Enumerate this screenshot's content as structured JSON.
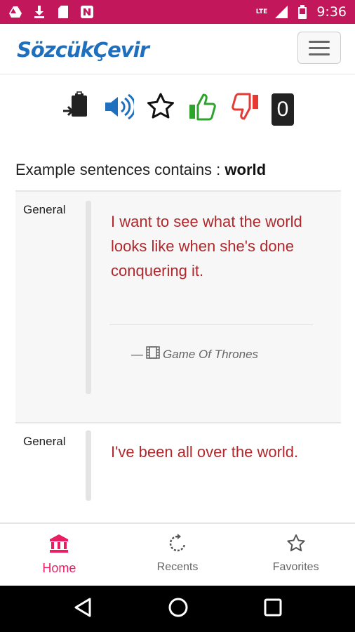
{
  "status_bar": {
    "time": "9:36",
    "network": "LTE",
    "icons": [
      "drive-icon",
      "download-icon",
      "sd-card-icon",
      "n-icon",
      "signal-icon",
      "battery-icon"
    ]
  },
  "app_bar": {
    "brand": "SözcükÇevir",
    "menu_icon": "hamburger-icon"
  },
  "toolbar": {
    "icons": [
      "paste-icon",
      "speaker-icon",
      "star-icon",
      "thumbs-up-icon",
      "thumbs-down-icon"
    ],
    "vote_count": "0",
    "colors": {
      "speaker": "#1f6fbf",
      "like": "#2ea32e",
      "dislike": "#e53935"
    }
  },
  "heading": {
    "prefix": "Example sentences contains : ",
    "term": "world"
  },
  "examples": [
    {
      "category": "General",
      "sentence": "I want to see what the world looks like when she's done conquering it.",
      "source_prefix": "—",
      "source": "Game Of Thrones"
    },
    {
      "category": "General",
      "sentence": "I've been all over the world."
    }
  ],
  "bottom_nav": {
    "items": [
      {
        "label": "Home",
        "icon": "bank-icon",
        "active": true
      },
      {
        "label": "Recents",
        "icon": "refresh-icon",
        "active": false
      },
      {
        "label": "Favorites",
        "icon": "star-icon",
        "active": false
      }
    ],
    "accent": "#e91e63"
  },
  "system_nav": [
    "back-icon",
    "home-icon",
    "overview-icon"
  ]
}
